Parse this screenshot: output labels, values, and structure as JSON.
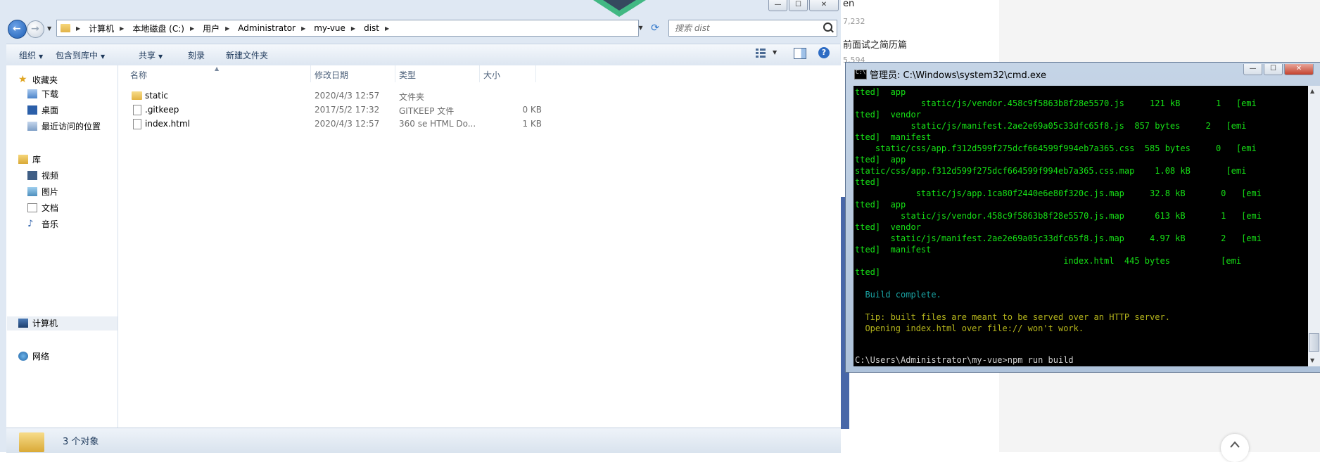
{
  "background_page": {
    "partial_lines": [
      {
        "text": "en",
        "kind": "main"
      },
      {
        "text": "7,232",
        "kind": "sub"
      },
      {
        "text": "前面试之简历篇",
        "kind": "main"
      },
      {
        "text": "5,594",
        "kind": "sub"
      }
    ],
    "accent_color": "#4867a8"
  },
  "explorer": {
    "window_controls": {
      "minimize": "—",
      "maximize": "☐",
      "close": "✕"
    },
    "nav": {
      "back": "←",
      "forward": "→",
      "recent": "▼"
    },
    "address": {
      "crumbs": [
        "计算机",
        "本地磁盘 (C:)",
        "用户",
        "Administrator",
        "my-vue",
        "dist"
      ],
      "separator": "▶"
    },
    "search": {
      "placeholder": "搜索 dist"
    },
    "toolbar": {
      "organize": "组织",
      "include_in_library": "包含到库中",
      "share": "共享",
      "burn": "刻录",
      "new_folder": "新建文件夹",
      "dropdown_arrow": "▼"
    },
    "navpane": {
      "favorites_header": "收藏夹",
      "favorites": [
        "下载",
        "桌面",
        "最近访问的位置"
      ],
      "libraries_header": "库",
      "libraries": [
        "视频",
        "图片",
        "文档",
        "音乐"
      ],
      "computer": "计算机",
      "network": "网络"
    },
    "columns": {
      "name": "名称",
      "date": "修改日期",
      "type": "类型",
      "size": "大小"
    },
    "files": [
      {
        "name": "static",
        "date": "2020/4/3 12:57",
        "type": "文件夹",
        "size": "",
        "icon": "folder-icon"
      },
      {
        "name": ".gitkeep",
        "date": "2017/5/2 17:32",
        "type": "GITKEEP 文件",
        "size": "0 KB",
        "icon": "file-icon"
      },
      {
        "name": "index.html",
        "date": "2020/4/3 12:57",
        "type": "360 se HTML Do...",
        "size": "1 KB",
        "icon": "file-icon"
      }
    ],
    "status": {
      "item_count": "3 个对象"
    }
  },
  "cmd": {
    "title": "管理员: C:\\Windows\\system32\\cmd.exe",
    "lines": [
      {
        "text": "tted]  app",
        "color": "g"
      },
      {
        "text": "             static/js/vendor.458c9f5863b8f28e5570.js     121 kB       1   [emi",
        "color": "g"
      },
      {
        "text": "tted]  vendor",
        "color": "g"
      },
      {
        "text": "           static/js/manifest.2ae2e69a05c33dfc65f8.js  857 bytes     2   [emi",
        "color": "g"
      },
      {
        "text": "tted]  manifest",
        "color": "g"
      },
      {
        "text": "    static/css/app.f312d599f275dcf664599f994eb7a365.css  585 bytes     0   [emi",
        "color": "g"
      },
      {
        "text": "tted]  app",
        "color": "g"
      },
      {
        "text": "static/css/app.f312d599f275dcf664599f994eb7a365.css.map    1.08 kB       [emi",
        "color": "g"
      },
      {
        "text": "tted]",
        "color": "g"
      },
      {
        "text": "            static/js/app.1ca80f2440e6e80f320c.js.map     32.8 kB       0   [emi",
        "color": "g"
      },
      {
        "text": "tted]  app",
        "color": "g"
      },
      {
        "text": "         static/js/vendor.458c9f5863b8f28e5570.js.map      613 kB       1   [emi",
        "color": "g"
      },
      {
        "text": "tted]  vendor",
        "color": "g"
      },
      {
        "text": "       static/js/manifest.2ae2e69a05c33dfc65f8.js.map     4.97 kB       2   [emi",
        "color": "g"
      },
      {
        "text": "tted]  manifest",
        "color": "g"
      },
      {
        "text": "                                         index.html  445 bytes          [emi",
        "color": "g"
      },
      {
        "text": "tted]",
        "color": "g"
      },
      {
        "text": "",
        "color": "g"
      },
      {
        "text": "  Build complete.",
        "color": "c"
      },
      {
        "text": "",
        "color": "g"
      },
      {
        "text": "  Tip: built files are meant to be served over an HTTP server.",
        "color": "y"
      },
      {
        "text": "  Opening index.html over file:// won't work.",
        "color": "y"
      },
      {
        "text": "",
        "color": "g"
      },
      {
        "text": "",
        "color": "g"
      },
      {
        "text": "C:\\Users\\Administrator\\my-vue>npm run build",
        "color": "w"
      }
    ],
    "controls": {
      "minimize": "—",
      "maximize": "☐",
      "close": "✕"
    }
  }
}
